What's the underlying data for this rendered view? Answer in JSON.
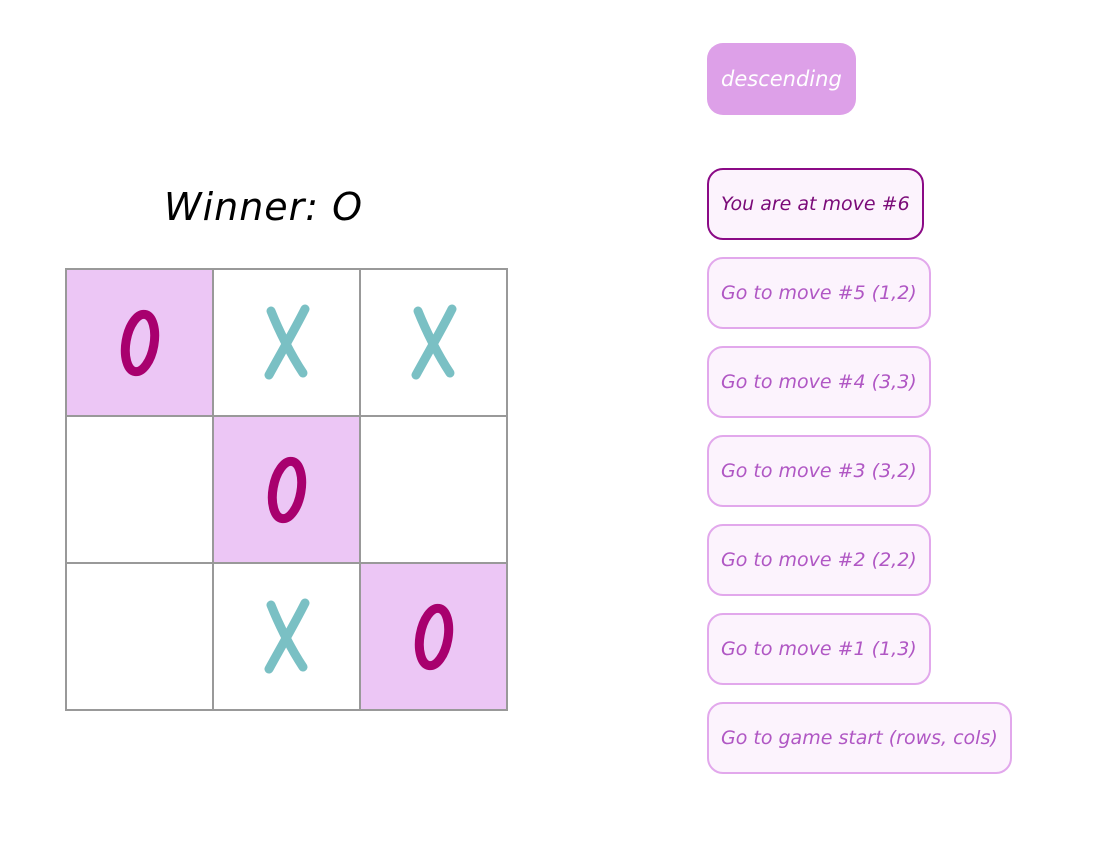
{
  "status": "Winner: O",
  "toggle_label": "descending",
  "colors": {
    "x_mark": "#7ac0c4",
    "o_mark": "#a8006e",
    "win_bg": "#ecc6f5",
    "button_bg": "#dda0e8"
  },
  "board": {
    "squares": [
      "O",
      "X",
      "X",
      "",
      "O",
      "",
      "",
      "X",
      "O"
    ],
    "winning_line": [
      0,
      4,
      8
    ]
  },
  "moves": [
    {
      "label": "You are at move #6",
      "current": true
    },
    {
      "label": "Go to move #5 (1,2)",
      "current": false
    },
    {
      "label": "Go to move #4 (3,3)",
      "current": false
    },
    {
      "label": "Go to move #3 (3,2)",
      "current": false
    },
    {
      "label": "Go to move #2 (2,2)",
      "current": false
    },
    {
      "label": "Go to move #1 (1,3)",
      "current": false
    },
    {
      "label": "Go to game start (rows, cols)",
      "current": false
    }
  ]
}
